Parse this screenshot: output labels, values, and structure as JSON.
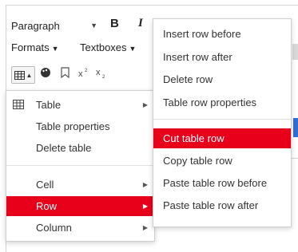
{
  "toolbar": {
    "paragraph_select": "Paragraph",
    "bold_label": "B",
    "italic_label": "I",
    "formats_label": "Formats",
    "textboxes_label": "Textboxes"
  },
  "left_menu": {
    "items": [
      {
        "label": "Table",
        "icon": "table-icon",
        "has_submenu": true,
        "active": false
      },
      {
        "label": "Table properties",
        "has_submenu": false,
        "active": false
      },
      {
        "label": "Delete table",
        "has_submenu": false,
        "active": false
      },
      {
        "label": "Cell",
        "has_submenu": true,
        "active": false
      },
      {
        "label": "Row",
        "has_submenu": true,
        "active": true
      },
      {
        "label": "Column",
        "has_submenu": true,
        "active": false
      }
    ]
  },
  "right_menu": {
    "items": [
      {
        "label": "Insert row before",
        "active": false
      },
      {
        "label": "Insert row after",
        "active": false
      },
      {
        "label": "Delete row",
        "active": false
      },
      {
        "label": "Table row properties",
        "active": false
      },
      {
        "label": "Cut table row",
        "active": true
      },
      {
        "label": "Copy table row",
        "active": false
      },
      {
        "label": "Paste table row before",
        "active": false
      },
      {
        "label": "Paste table row after",
        "active": false
      }
    ]
  },
  "colors": {
    "active_bg": "#e8001b",
    "active_text": "#ffffff",
    "accent_blue": "#2f6fd6"
  }
}
